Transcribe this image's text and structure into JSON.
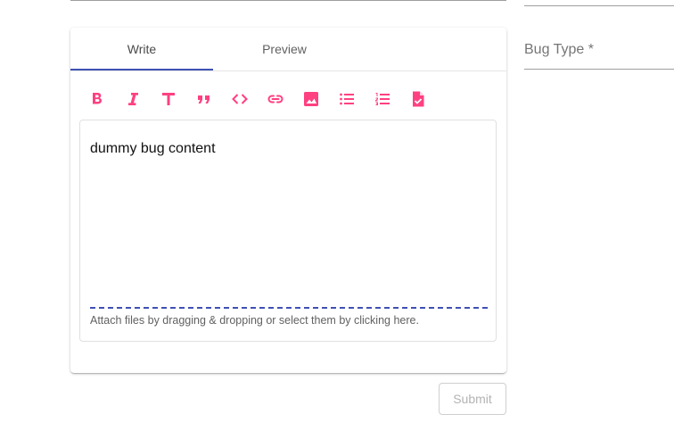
{
  "editor": {
    "tabs": [
      {
        "label": "Write",
        "selected": true
      },
      {
        "label": "Preview",
        "selected": false
      }
    ],
    "toolbar": [
      {
        "icon": "bold-icon"
      },
      {
        "icon": "italic-icon"
      },
      {
        "icon": "header-icon"
      },
      {
        "icon": "quote-icon"
      },
      {
        "icon": "code-icon"
      },
      {
        "icon": "link-icon"
      },
      {
        "icon": "image-icon"
      },
      {
        "icon": "unordered-list-icon"
      },
      {
        "icon": "ordered-list-icon"
      },
      {
        "icon": "checked-list-icon"
      }
    ],
    "content": "dummy bug content",
    "attach_hint": "Attach files by dragging & dropping or select them by clicking here."
  },
  "bug_type": {
    "label": "Bug Type *",
    "value": ""
  },
  "submit": {
    "label": "Submit",
    "disabled": true
  },
  "colors": {
    "accent": "#ff4081",
    "primary": "#3f51b5",
    "muted_text": "#757575"
  }
}
